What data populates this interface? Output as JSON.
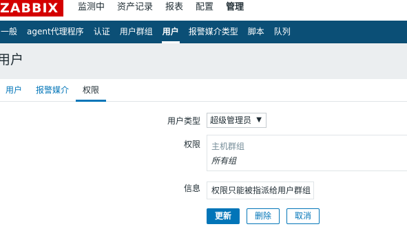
{
  "logo": "ZABBIX",
  "top_nav": [
    "监测中",
    "资产记录",
    "报表",
    "配置",
    "管理"
  ],
  "sub_nav": [
    "一般",
    "agent代理程序",
    "认证",
    "用户群组",
    "用户",
    "报警媒介类型",
    "脚本",
    "队列"
  ],
  "page_title": "用户",
  "tabs": [
    "用户",
    "报警媒介",
    "权限"
  ],
  "form": {
    "user_type_label": "用户类型",
    "user_type_value": "超级管理员",
    "permissions_label": "权限",
    "permissions_header": "主机群组",
    "permissions_row": "所有组",
    "info_label": "信息",
    "info_text": "权限只能被指派给用户群组"
  },
  "buttons": {
    "update": "更新",
    "delete": "删除",
    "cancel": "取消"
  }
}
